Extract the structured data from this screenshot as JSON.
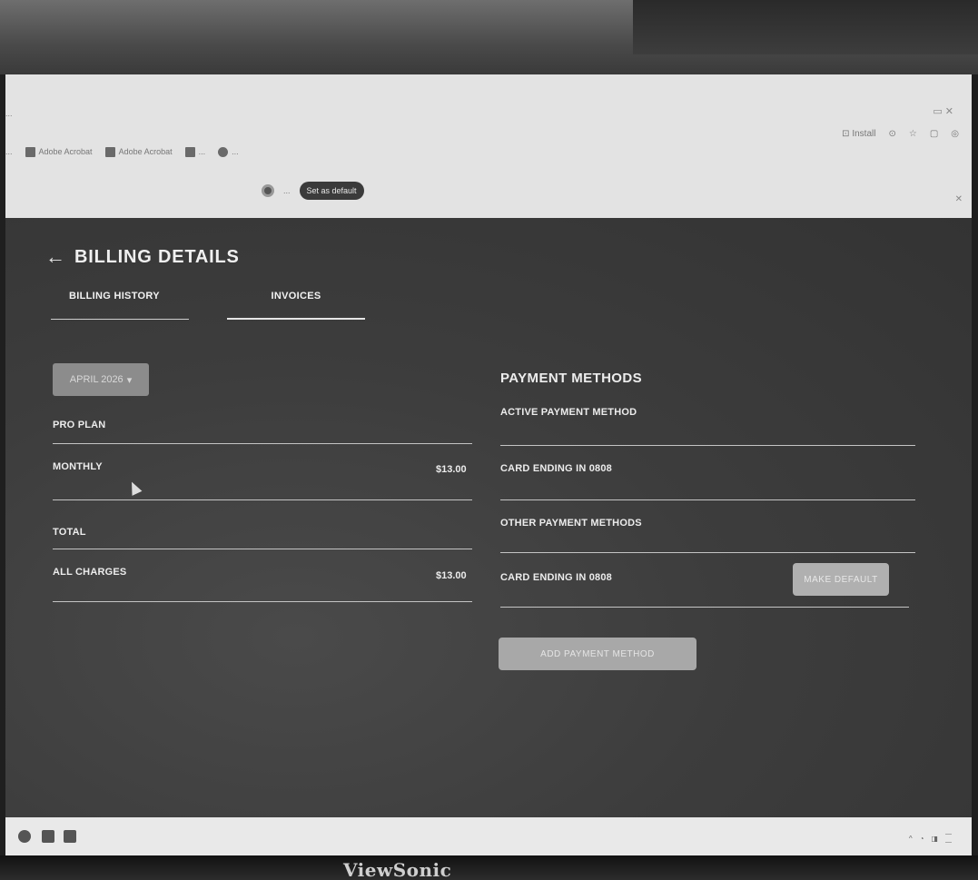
{
  "browser": {
    "url": "...",
    "bookmarks": [
      {
        "label": "...",
        "icon": "bookmark-icon"
      },
      {
        "label": "Adobe Acrobat",
        "icon": "adobe-icon"
      },
      {
        "label": "Adobe Acrobat",
        "icon": "adobe-icon"
      },
      {
        "label": "...",
        "icon": "doc-icon"
      },
      {
        "label": "...",
        "icon": "globe-icon"
      }
    ],
    "install_label": "Install",
    "notice_text": "...",
    "set_default_label": "Set as default"
  },
  "page": {
    "title": "BILLING DETAILS",
    "back_icon": "arrow-left-icon",
    "tabs": [
      {
        "label": "BILLING HISTORY",
        "active": false
      },
      {
        "label": "INVOICES",
        "active": true
      }
    ]
  },
  "invoice": {
    "month_selector": "APRIL 2026",
    "plan": "PRO PLAN",
    "line_item_label": "MONTHLY",
    "line_item_amount": "$13.00",
    "total_heading": "TOTAL",
    "all_charges_label": "ALL CHARGES",
    "all_charges_amount": "$13.00"
  },
  "payment_methods": {
    "title": "PAYMENT METHODS",
    "active_heading": "ACTIVE PAYMENT METHOD",
    "active_card": "CARD ENDING IN 0808",
    "other_heading": "OTHER PAYMENT METHODS",
    "other_card": "CARD ENDING IN 0808",
    "make_default_label": "MAKE DEFAULT",
    "add_method_label": "ADD PAYMENT METHOD"
  },
  "monitor": {
    "brand": "ViewSonic"
  }
}
